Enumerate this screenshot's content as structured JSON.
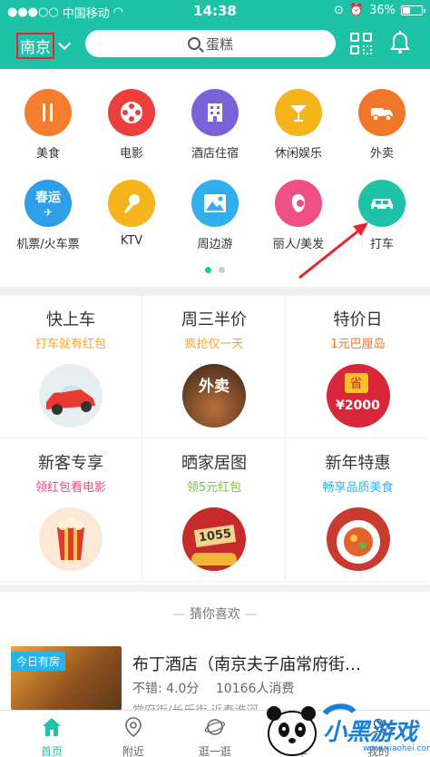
{
  "status": {
    "carrier": "中国移动",
    "time": "14:38",
    "battery": "36%"
  },
  "nav": {
    "city": "南京",
    "search_placeholder": "蛋糕"
  },
  "categories": [
    {
      "label": "美食",
      "icon": "food-icon",
      "color": "#f47d2f"
    },
    {
      "label": "电影",
      "icon": "film-icon",
      "color": "#ed3d3d"
    },
    {
      "label": "酒店住宿",
      "icon": "hotel-icon",
      "color": "#7b62d8"
    },
    {
      "label": "休闲娱乐",
      "icon": "cocktail-icon",
      "color": "#f5b31c"
    },
    {
      "label": "外卖",
      "icon": "delivery-icon",
      "color": "#f0762a"
    },
    {
      "label": "机票/火车票",
      "icon": "flight-icon",
      "color": "#2f9ee8",
      "text": "春运"
    },
    {
      "label": "KTV",
      "icon": "microphone-icon",
      "color": "#f5b31c"
    },
    {
      "label": "周边游",
      "icon": "landscape-icon",
      "color": "#2fb0ec"
    },
    {
      "label": "丽人/美发",
      "icon": "beauty-icon",
      "color": "#ef4f86"
    },
    {
      "label": "打车",
      "icon": "taxi-icon",
      "color": "#1ec2a7"
    }
  ],
  "pager": {
    "pages": 2,
    "current": 1
  },
  "promos": [
    {
      "title": "快上车",
      "subtitle": "打车就有红包",
      "subtitle_color": "#f5a623",
      "img": "red-car-image"
    },
    {
      "title": "周三半价",
      "subtitle": "疯抢仅一天",
      "subtitle_color": "#f5a623",
      "img": "takeaway-food-image",
      "img_text": "外卖"
    },
    {
      "title": "特价日",
      "subtitle": "1元巴厘岛",
      "subtitle_color": "#f0762a",
      "img": "voucher-image",
      "img_text": "省",
      "img_sub": "¥2000"
    },
    {
      "title": "新客专享",
      "subtitle": "领红包看电影",
      "subtitle_color": "#e8507d",
      "img": "popcorn-image"
    },
    {
      "title": "晒家居图",
      "subtitle": "领5元红包",
      "subtitle_color": "#7dc63b",
      "img": "coins-image",
      "img_text": "1055"
    },
    {
      "title": "新年特惠",
      "subtitle": "畅享品质美食",
      "subtitle_color": "#2fb0ec",
      "img": "dish-image"
    }
  ],
  "guess": {
    "heading": "猜你喜欢",
    "item": {
      "badge": "今日有房",
      "name": "布丁酒店（南京夫子庙常府街…",
      "rating": "不错: 4.0分",
      "consumed": "10166人消费",
      "meta_cut": "常府街/长乐街 近秦淮河"
    }
  },
  "tabs": [
    {
      "label": "首页",
      "icon": "home-icon",
      "active": true
    },
    {
      "label": "附近",
      "icon": "location-pin-icon",
      "active": false
    },
    {
      "label": "逛一逛",
      "icon": "planet-icon",
      "active": false
    },
    {
      "label": "订单",
      "icon": "order-icon",
      "active": false
    },
    {
      "label": "我的",
      "icon": "user-icon",
      "active": false
    }
  ],
  "watermark": {
    "title": "小黑游戏",
    "url": "www.xiaohei.com"
  },
  "accent": "#1ec2a7"
}
